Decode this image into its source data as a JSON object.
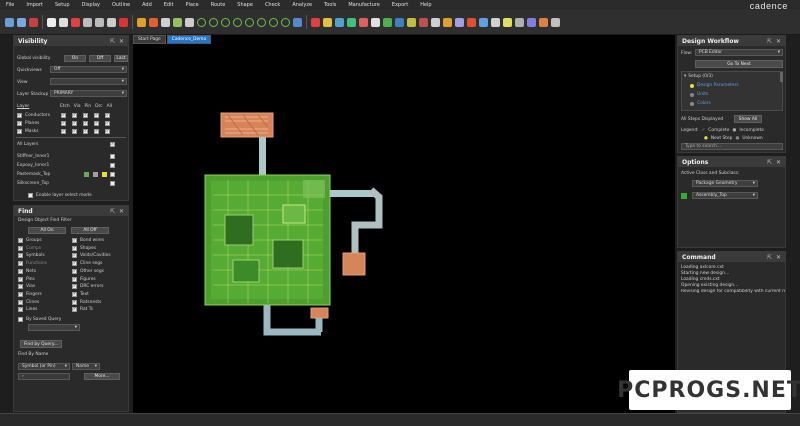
{
  "menu": [
    "File",
    "Import",
    "Setup",
    "Display",
    "Outline",
    "Add",
    "Edit",
    "Place",
    "Route",
    "Shape",
    "Check",
    "Analyze",
    "Tools",
    "Manufacture",
    "Export",
    "Help"
  ],
  "brand": "cadence",
  "tabs": [
    {
      "label": "Start Page"
    },
    {
      "label": "Cadence_Demo"
    }
  ],
  "visibility": {
    "title": "Visibility",
    "global_label": "Global visibility",
    "on": "On",
    "off": "Off",
    "last": "Last",
    "quickviews_label": "Quickviews",
    "quickviews_value": "Off",
    "view_label": "View",
    "stackup_label": "Layer Stackup",
    "stackup_value": "PRIMARY",
    "col_layer": "Layer",
    "col_etch": "Etch",
    "col_via": "Via",
    "col_pin": "Pin",
    "col_drc": "Drc",
    "col_all": "All",
    "rows": [
      "Conductors",
      "Planes",
      "Masks"
    ],
    "all_layers": "All Layers",
    "layers": [
      "Stiffner_Inner1",
      "Expoxy_Inner1",
      "Pastemask_Top",
      "Silkscreen_Top"
    ],
    "enable_layer": "Enable layer select mode"
  },
  "find": {
    "title": "Find",
    "filter_label": "Design Object Find Filter",
    "all_on": "All On",
    "all_off": "All Off",
    "left_items": [
      "Groups",
      "Comps",
      "Symbols",
      "Functions",
      "Nets",
      "Pins",
      "Vias",
      "Fingers",
      "Clines",
      "Lines"
    ],
    "right_items": [
      "Bond wires",
      "Shapes",
      "Voids/Cavities",
      "Cline segs",
      "Other segs",
      "Figures",
      "DRC errors",
      "Text",
      "Ratsnests",
      "Rat Ts"
    ],
    "saved_query": "By Saved Query",
    "find_query": "Find by Query...",
    "find_name": "Find By Name",
    "name_type": "Symbol (or Pin)",
    "name_field": "Name",
    "more": "More..."
  },
  "workflow": {
    "title": "Design Workflow",
    "flow_label": "Flow:",
    "flow_value": "PCB Editor",
    "go_next": "Go To Next",
    "setup": "Setup (0/3)",
    "steps": [
      "Design Parameters",
      "Units",
      "Colors"
    ],
    "all_steps": "All Steps Displayed",
    "show_all": "Show All",
    "legend": "Legend:",
    "complete": "Complete",
    "incomplete": "Incomplete",
    "next_step": "Next Step",
    "unknown": "Unknown",
    "search_placeholder": "Type to search..."
  },
  "options": {
    "title": "Options",
    "active_label": "Active Class and Subclass:",
    "class_value": "Package Geometry",
    "subclass_value": "Assembly_Top"
  },
  "command": {
    "title": "Command",
    "lines": [
      "Loading axlcore.cxt",
      "Starting new design...",
      "Loading cmds.cxt",
      "Opening existing design...",
      "Revising design for compatibility with current rel"
    ]
  },
  "watermark": "PCPROGS.NET",
  "colors": {
    "accent": "#2277cc",
    "board_green": "#4ea02e",
    "flex": "#e08050"
  }
}
